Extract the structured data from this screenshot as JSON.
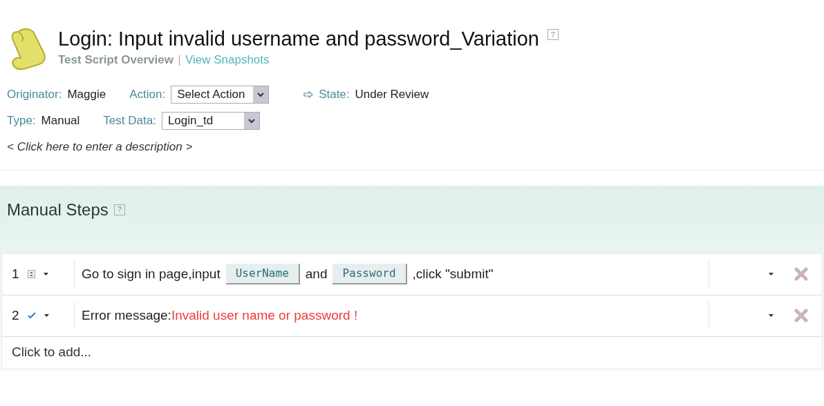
{
  "header": {
    "title": "Login: Input invalid username and password_Variation",
    "help": "?",
    "links": [
      {
        "label": "Test Script Overview",
        "selected": true
      },
      {
        "label": "View Snapshots",
        "selected": false
      }
    ]
  },
  "fields": [
    [
      {
        "kind": "text",
        "label": "Originator:",
        "value": "Maggie"
      },
      {
        "kind": "select",
        "label": "Action:",
        "value": "Select Action"
      },
      {
        "kind": "state",
        "label": "State:",
        "value": "Under Review"
      }
    ],
    [
      {
        "kind": "text",
        "label": "Type:",
        "value": "Manual"
      },
      {
        "kind": "select",
        "label": "Test Data:",
        "value": "Login_td"
      }
    ]
  ],
  "description": "< Click here to enter a description >",
  "steps_panel": {
    "title": "Manual Steps",
    "help": "?",
    "steps": [
      {
        "number": "1",
        "kind": "action",
        "parts": [
          {
            "kind": "text",
            "text": "Go to sign in page,input"
          },
          {
            "kind": "field",
            "text": "UserName"
          },
          {
            "kind": "text",
            "text": "and"
          },
          {
            "kind": "field",
            "text": "Password"
          },
          {
            "kind": "text",
            "text": ",click \"submit\""
          }
        ]
      },
      {
        "number": "2",
        "kind": "verify",
        "parts": [
          {
            "kind": "text",
            "text": "Error message:"
          },
          {
            "kind": "error",
            "text": "Invalid user name or password !"
          }
        ]
      }
    ],
    "add": "Click to add..."
  }
}
